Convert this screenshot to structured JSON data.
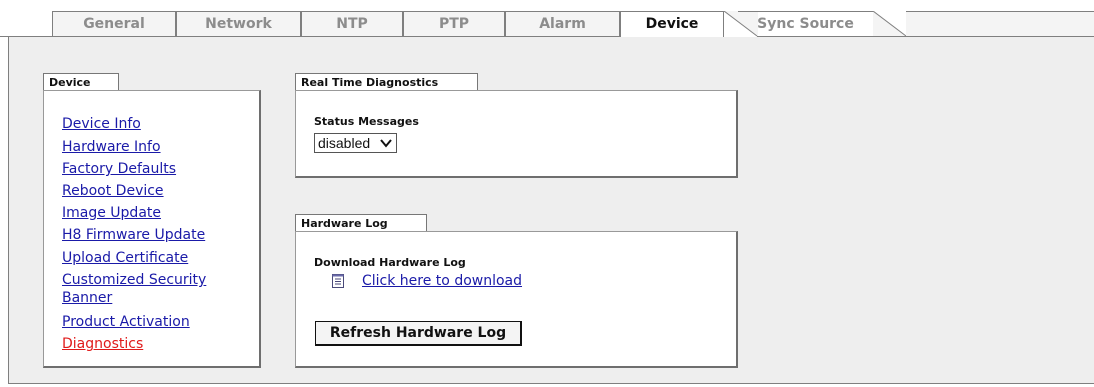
{
  "tabs": [
    {
      "label": "General"
    },
    {
      "label": "Network"
    },
    {
      "label": "NTP"
    },
    {
      "label": "PTP"
    },
    {
      "label": "Alarm"
    },
    {
      "label": "Device",
      "active": true
    },
    {
      "label": "Sync Source"
    }
  ],
  "device_menu": {
    "title": "Device",
    "items": [
      {
        "label": "Device Info"
      },
      {
        "label": "Hardware Info"
      },
      {
        "label": "Factory Defaults"
      },
      {
        "label": "Reboot Device"
      },
      {
        "label": "Image Update"
      },
      {
        "label": "H8 Firmware Update"
      },
      {
        "label": "Upload Certificate"
      },
      {
        "label": "Customized Security"
      },
      {
        "label": "Banner"
      },
      {
        "label": "Product Activation"
      },
      {
        "label": "Diagnostics",
        "current": true
      }
    ]
  },
  "realtime": {
    "title": "Real Time Diagnostics",
    "status_label": "Status Messages",
    "status_value": "disabled"
  },
  "hwlog": {
    "title": "Hardware Log",
    "download_label": "Download Hardware Log",
    "download_link": "Click here to download",
    "refresh_button": "Refresh Hardware Log"
  },
  "colors": {
    "link": "#1a1aa8",
    "link_current": "#e01a1a",
    "panel_bg": "#eeeeee"
  },
  "icons": {
    "select_arrow": "chevron-down-icon",
    "download": "document-icon"
  }
}
